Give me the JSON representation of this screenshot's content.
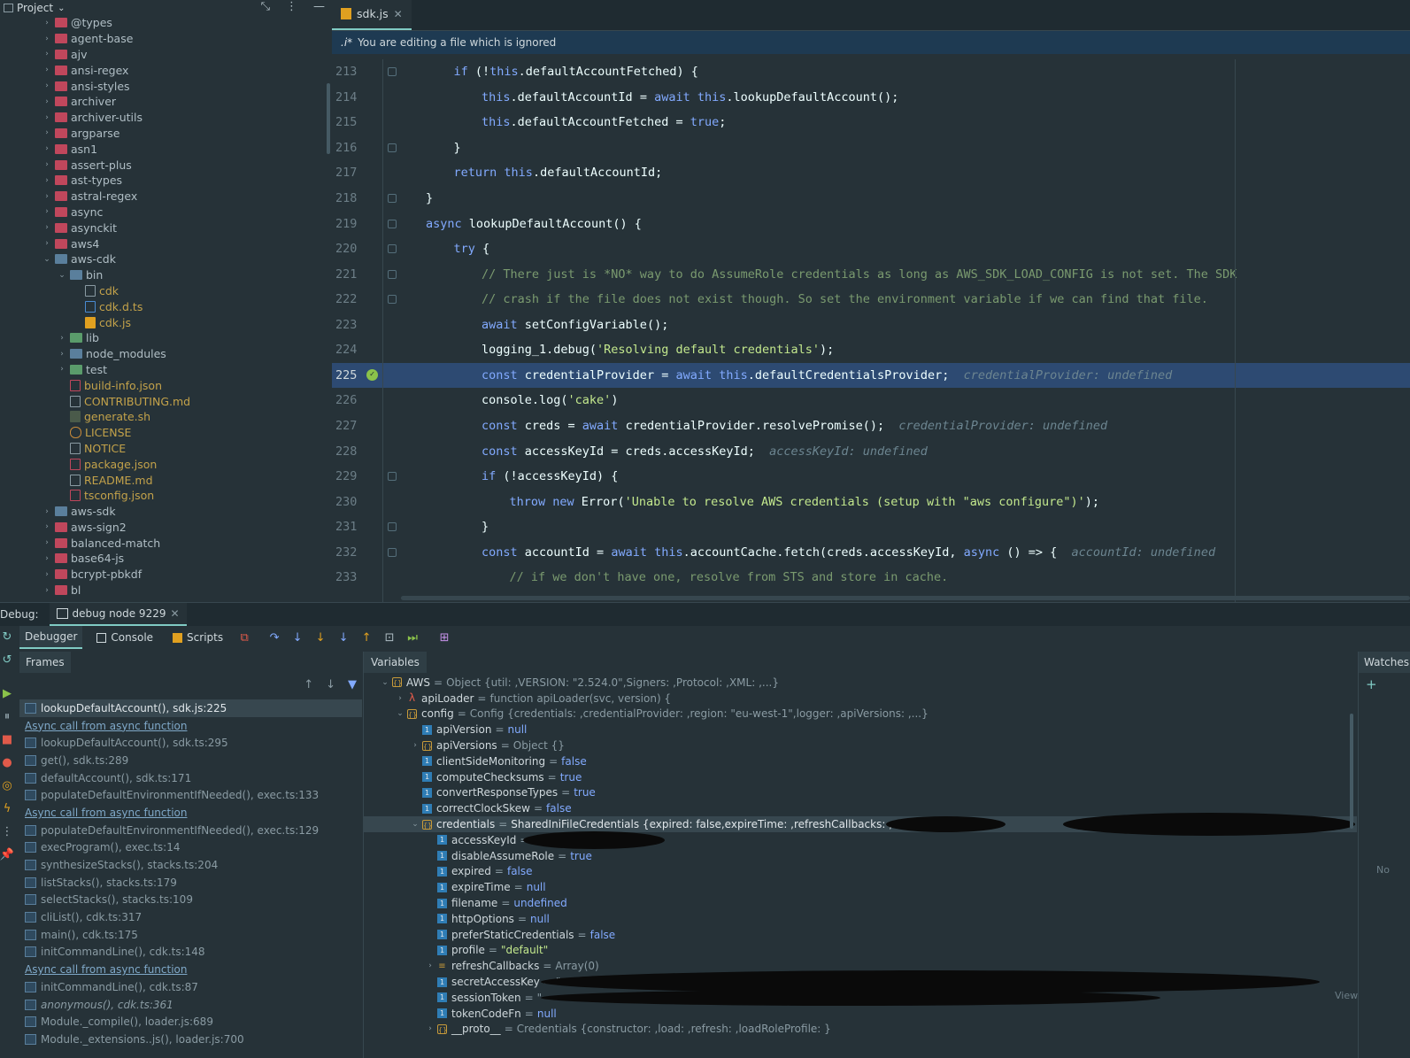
{
  "project": {
    "title": "Project",
    "tree": [
      {
        "label": "@types",
        "type": "folder-red",
        "indent": 1,
        "chev": "›"
      },
      {
        "label": "agent-base",
        "type": "folder-red",
        "indent": 1,
        "chev": "›"
      },
      {
        "label": "ajv",
        "type": "folder-red",
        "indent": 1,
        "chev": "›"
      },
      {
        "label": "ansi-regex",
        "type": "folder-red",
        "indent": 1,
        "chev": "›"
      },
      {
        "label": "ansi-styles",
        "type": "folder-red",
        "indent": 1,
        "chev": "›"
      },
      {
        "label": "archiver",
        "type": "folder-red",
        "indent": 1,
        "chev": "›"
      },
      {
        "label": "archiver-utils",
        "type": "folder-red",
        "indent": 1,
        "chev": "›"
      },
      {
        "label": "argparse",
        "type": "folder-red",
        "indent": 1,
        "chev": "›"
      },
      {
        "label": "asn1",
        "type": "folder-red",
        "indent": 1,
        "chev": "›"
      },
      {
        "label": "assert-plus",
        "type": "folder-red",
        "indent": 1,
        "chev": "›"
      },
      {
        "label": "ast-types",
        "type": "folder-red",
        "indent": 1,
        "chev": "›"
      },
      {
        "label": "astral-regex",
        "type": "folder-red",
        "indent": 1,
        "chev": "›"
      },
      {
        "label": "async",
        "type": "folder-red",
        "indent": 1,
        "chev": "›"
      },
      {
        "label": "asynckit",
        "type": "folder-red",
        "indent": 1,
        "chev": "›"
      },
      {
        "label": "aws4",
        "type": "folder-red",
        "indent": 1,
        "chev": "›"
      },
      {
        "label": "aws-cdk",
        "type": "folder-blue",
        "indent": 1,
        "chev": "⌄"
      },
      {
        "label": "bin",
        "type": "folder-blue",
        "indent": 2,
        "chev": "⌄"
      },
      {
        "label": "cdk",
        "type": "file-plain",
        "indent": 3,
        "chev": "",
        "style": "ignored"
      },
      {
        "label": "cdk.d.ts",
        "type": "file-ts",
        "indent": 3,
        "chev": "",
        "style": "ignored"
      },
      {
        "label": "cdk.js",
        "type": "file-js",
        "indent": 3,
        "chev": "",
        "style": "ignored"
      },
      {
        "label": "lib",
        "type": "folder-green",
        "indent": 2,
        "chev": "›"
      },
      {
        "label": "node_modules",
        "type": "folder-blue",
        "indent": 2,
        "chev": "›"
      },
      {
        "label": "test",
        "type": "folder-green",
        "indent": 2,
        "chev": "›"
      },
      {
        "label": "build-info.json",
        "type": "file-json",
        "indent": 2,
        "chev": "",
        "style": "ignored"
      },
      {
        "label": "CONTRIBUTING.md",
        "type": "file-plain",
        "indent": 2,
        "chev": "",
        "style": "ignored"
      },
      {
        "label": "generate.sh",
        "type": "file-sh",
        "indent": 2,
        "chev": "",
        "style": "ignored"
      },
      {
        "label": "LICENSE",
        "type": "file-lic",
        "indent": 2,
        "chev": "",
        "style": "ignored"
      },
      {
        "label": "NOTICE",
        "type": "file-plain",
        "indent": 2,
        "chev": "",
        "style": "ignored"
      },
      {
        "label": "package.json",
        "type": "file-json",
        "indent": 2,
        "chev": "",
        "style": "ignored"
      },
      {
        "label": "README.md",
        "type": "file-plain",
        "indent": 2,
        "chev": "",
        "style": "ignored"
      },
      {
        "label": "tsconfig.json",
        "type": "file-json",
        "indent": 2,
        "chev": "",
        "style": "ignored"
      },
      {
        "label": "aws-sdk",
        "type": "folder-blue",
        "indent": 1,
        "chev": "›"
      },
      {
        "label": "aws-sign2",
        "type": "folder-red",
        "indent": 1,
        "chev": "›"
      },
      {
        "label": "balanced-match",
        "type": "folder-red",
        "indent": 1,
        "chev": "›"
      },
      {
        "label": "base64-js",
        "type": "folder-red",
        "indent": 1,
        "chev": "›"
      },
      {
        "label": "bcrypt-pbkdf",
        "type": "folder-red",
        "indent": 1,
        "chev": "›"
      },
      {
        "label": "bl",
        "type": "folder-red",
        "indent": 1,
        "chev": "›"
      }
    ]
  },
  "editor": {
    "tab_label": "sdk.js",
    "notice_icon": ".i*",
    "notice_text": "You are editing a file which is ignored",
    "current_line": 225,
    "lines": [
      {
        "n": "213",
        "indent": 1,
        "html": "<span class=\"kw\">if</span> (!<span class=\"this\">this</span>.defaultAccountFetched) {",
        "fold": true
      },
      {
        "n": "214",
        "indent": 2,
        "html": "<span class=\"this\">this</span>.defaultAccountId = <span class=\"kw\">await</span> <span class=\"this\">this</span>.lookupDefaultAccount();"
      },
      {
        "n": "215",
        "indent": 2,
        "html": "<span class=\"this\">this</span>.defaultAccountFetched = <span class=\"kw\">true</span>;"
      },
      {
        "n": "216",
        "indent": 1,
        "html": "}",
        "fold": true
      },
      {
        "n": "217",
        "indent": 1,
        "html": "<span class=\"kw\">return</span> <span class=\"this\">this</span>.defaultAccountId;"
      },
      {
        "n": "218",
        "indent": 0,
        "html": "}",
        "fold": true
      },
      {
        "n": "219",
        "indent": 0,
        "html": "<span class=\"kw\">async</span> lookupDefaultAccount() {",
        "fold": true
      },
      {
        "n": "220",
        "indent": 1,
        "html": "<span class=\"kw\">try</span> {",
        "fold": true
      },
      {
        "n": "221",
        "indent": 2,
        "html": "<span class=\"cmt\">// There just is *NO* way to do AssumeRole credentials as long as AWS_SDK_LOAD_CONFIG is not set. The SDK</span>",
        "fold": true
      },
      {
        "n": "222",
        "indent": 2,
        "html": "<span class=\"cmt\">// crash if the file does not exist though. So set the environment variable if we can find that file.</span>",
        "fold": true
      },
      {
        "n": "223",
        "indent": 2,
        "html": "<span class=\"kw\">await</span> setConfigVariable();"
      },
      {
        "n": "224",
        "indent": 2,
        "html": "logging_1.debug(<span class=\"str\">'Resolving default credentials'</span>);"
      },
      {
        "n": "225",
        "indent": 2,
        "html": "<span class=\"kw\">const</span> credentialProvider = <span class=\"kw\">await</span> <span class=\"this\">this</span>.defaultCredentialsProvider;  <span class=\"inline-val\">credentialProvider: undefined</span>",
        "current": true
      },
      {
        "n": "226",
        "indent": 2,
        "html": "console.log(<span class=\"str\">'cake'</span>)"
      },
      {
        "n": "227",
        "indent": 2,
        "html": "<span class=\"kw\">const</span> creds = <span class=\"kw\">await</span> credentialProvider.resolvePromise();  <span class=\"inline-val\">credentialProvider: undefined</span>"
      },
      {
        "n": "228",
        "indent": 2,
        "html": "<span class=\"kw\">const</span> accessKeyId = creds.accessKeyId;  <span class=\"inline-val\">accessKeyId: undefined</span>"
      },
      {
        "n": "229",
        "indent": 2,
        "html": "<span class=\"kw\">if</span> (!accessKeyId) {",
        "fold": true
      },
      {
        "n": "230",
        "indent": 3,
        "html": "<span class=\"kw\">throw</span> <span class=\"kw\">new</span> Error(<span class=\"str\">'Unable to resolve AWS credentials (setup with \"aws configure\")'</span>);"
      },
      {
        "n": "231",
        "indent": 2,
        "html": "}",
        "fold": true
      },
      {
        "n": "232",
        "indent": 2,
        "html": "<span class=\"kw\">const</span> accountId = <span class=\"kw\">await</span> <span class=\"this\">this</span>.accountCache.fetch(creds.accessKeyId, <span class=\"kw\">async</span> () => {  <span class=\"inline-val\">accountId: undefined</span>",
        "fold": true
      },
      {
        "n": "233",
        "indent": 3,
        "html": "<span class=\"cmt\">// if we don't have one, resolve from STS and store in cache.</span>"
      }
    ]
  },
  "debug": {
    "label": "Debug:",
    "session": "debug node 9229",
    "tabs": {
      "debugger": "Debugger",
      "console": "Console",
      "scripts": "Scripts"
    },
    "frames_title": "Frames",
    "variables_title": "Variables",
    "watches_title": "Watches",
    "watches_empty": "No",
    "view_link": "View",
    "frames": [
      {
        "label": "lookupDefaultAccount(), sdk.js:225",
        "kind": "selected"
      },
      {
        "label": "Async call from async function",
        "kind": "async"
      },
      {
        "label": "lookupDefaultAccount(), sdk.ts:295",
        "kind": "normal"
      },
      {
        "label": "get(), sdk.ts:289",
        "kind": "normal"
      },
      {
        "label": "defaultAccount(), sdk.ts:171",
        "kind": "normal"
      },
      {
        "label": "populateDefaultEnvironmentIfNeeded(), exec.ts:133",
        "kind": "normal"
      },
      {
        "label": "Async call from async function",
        "kind": "async"
      },
      {
        "label": "populateDefaultEnvironmentIfNeeded(), exec.ts:129",
        "kind": "normal"
      },
      {
        "label": "execProgram(), exec.ts:14",
        "kind": "normal"
      },
      {
        "label": "synthesizeStacks(), stacks.ts:204",
        "kind": "normal"
      },
      {
        "label": "listStacks(), stacks.ts:179",
        "kind": "normal"
      },
      {
        "label": "selectStacks(), stacks.ts:109",
        "kind": "normal"
      },
      {
        "label": "cliList(), cdk.ts:317",
        "kind": "normal"
      },
      {
        "label": "main(), cdk.ts:175",
        "kind": "normal"
      },
      {
        "label": "initCommandLine(), cdk.ts:148",
        "kind": "normal"
      },
      {
        "label": "Async call from async function",
        "kind": "async"
      },
      {
        "label": "initCommandLine(), cdk.ts:87",
        "kind": "normal"
      },
      {
        "label": "anonymous(), cdk.ts:361",
        "kind": "normal"
      },
      {
        "label": "Module._compile(), loader.js:689",
        "kind": "normal"
      },
      {
        "label": "Module._extensions..js(), loader.js:700",
        "kind": "normal"
      }
    ],
    "variables": [
      {
        "indent": 0,
        "chev": "⌄",
        "icon": "obj",
        "name": "AWS",
        "val": "Object {util: ,VERSION: \"2.524.0\",Signers: ,Protocol: ,XML: ,...}",
        "vt": "plain"
      },
      {
        "indent": 1,
        "chev": "›",
        "icon": "fn",
        "name": "apiLoader",
        "val": "function apiLoader(svc, version) {",
        "vt": "plain"
      },
      {
        "indent": 1,
        "chev": "⌄",
        "icon": "obj",
        "name": "config",
        "val": "Config {credentials: ,credentialProvider: ,region: \"eu-west-1\",logger: ,apiVersions: ,...}",
        "vt": "plain"
      },
      {
        "indent": 2,
        "chev": "",
        "icon": "prim",
        "name": "apiVersion",
        "val": "null",
        "vt": "bool"
      },
      {
        "indent": 2,
        "chev": "›",
        "icon": "obj",
        "name": "apiVersions",
        "val": "Object {}",
        "vt": "plain"
      },
      {
        "indent": 2,
        "chev": "",
        "icon": "prim",
        "name": "clientSideMonitoring",
        "val": "false",
        "vt": "bool"
      },
      {
        "indent": 2,
        "chev": "",
        "icon": "prim",
        "name": "computeChecksums",
        "val": "true",
        "vt": "bool"
      },
      {
        "indent": 2,
        "chev": "",
        "icon": "prim",
        "name": "convertResponseTypes",
        "val": "true",
        "vt": "bool"
      },
      {
        "indent": 2,
        "chev": "",
        "icon": "prim",
        "name": "correctClockSkew",
        "val": "false",
        "vt": "bool"
      },
      {
        "indent": 2,
        "chev": "⌄",
        "icon": "obj",
        "name": "credentials",
        "val": "SharedIniFileCredentials {expired: false,expireTime: ,refreshCallbacks: ,accessKeyId: \"",
        "vt": "plain",
        "selected": true
      },
      {
        "indent": 3,
        "chev": "",
        "icon": "prim",
        "name": "accessKeyId",
        "val": "\"",
        "vt": "plain"
      },
      {
        "indent": 3,
        "chev": "",
        "icon": "prim",
        "name": "disableAssumeRole",
        "val": "true",
        "vt": "bool"
      },
      {
        "indent": 3,
        "chev": "",
        "icon": "prim",
        "name": "expired",
        "val": "false",
        "vt": "bool"
      },
      {
        "indent": 3,
        "chev": "",
        "icon": "prim",
        "name": "expireTime",
        "val": "null",
        "vt": "bool"
      },
      {
        "indent": 3,
        "chev": "",
        "icon": "prim",
        "name": "filename",
        "val": "undefined",
        "vt": "bool"
      },
      {
        "indent": 3,
        "chev": "",
        "icon": "prim",
        "name": "httpOptions",
        "val": "null",
        "vt": "bool"
      },
      {
        "indent": 3,
        "chev": "",
        "icon": "prim",
        "name": "preferStaticCredentials",
        "val": "false",
        "vt": "bool"
      },
      {
        "indent": 3,
        "chev": "",
        "icon": "prim",
        "name": "profile",
        "val": "\"default\"",
        "vt": "str"
      },
      {
        "indent": 3,
        "chev": "›",
        "icon": "arr",
        "name": "refreshCallbacks",
        "val": "Array(0)",
        "vt": "plain"
      },
      {
        "indent": 3,
        "chev": "",
        "icon": "prim",
        "name": "secretAccessKey",
        "val": "\"",
        "vt": "plain"
      },
      {
        "indent": 3,
        "chev": "",
        "icon": "prim",
        "name": "sessionToken",
        "val": "\"",
        "vt": "plain"
      },
      {
        "indent": 3,
        "chev": "",
        "icon": "prim",
        "name": "tokenCodeFn",
        "val": "null",
        "vt": "bool"
      },
      {
        "indent": 3,
        "chev": "›",
        "icon": "obj",
        "name": "__proto__",
        "val": "Credentials {constructor: ,load: ,refresh: ,loadRoleProfile: }",
        "vt": "plain"
      }
    ]
  }
}
